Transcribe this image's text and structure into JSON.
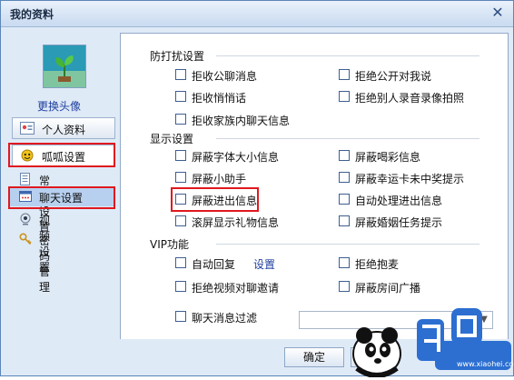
{
  "window": {
    "title": "我的资料",
    "close_symbol": "✕"
  },
  "sidebar": {
    "change_avatar": "更换头像",
    "items": [
      {
        "label": "个人资料"
      },
      {
        "label": "呱呱设置"
      }
    ],
    "sub_items": [
      {
        "label": "常规设置"
      },
      {
        "label": "聊天设置"
      },
      {
        "label": "视频设置"
      },
      {
        "label": "密码管理"
      }
    ]
  },
  "sections": {
    "disturb": {
      "title": "防打扰设置",
      "options": [
        "拒收公聊消息",
        "拒绝公开对我说",
        "拒收悄悄话",
        "拒绝别人录音录像拍照",
        "拒收家族内聊天信息"
      ]
    },
    "display": {
      "title": "显示设置",
      "options": [
        "屏蔽字体大小信息",
        "屏蔽喝彩信息",
        "屏蔽小助手",
        "屏蔽幸运卡未中奖提示",
        "屏蔽进出信息",
        "自动处理进出信息",
        "滚屏显示礼物信息",
        "屏蔽婚姻任务提示"
      ]
    },
    "vip": {
      "title": "VIP功能",
      "options": [
        "自动回复",
        "拒绝抱麦",
        "拒绝视频对聊邀请",
        "屏蔽房间广播",
        "聊天消息过滤"
      ],
      "settings_link": "设置"
    }
  },
  "filter_select": {
    "value": ""
  },
  "footer": {
    "ok": "确定"
  },
  "watermark": {
    "url": "www.xiaohei.com"
  },
  "colors": {
    "accent_highlight": "#e0191f",
    "link": "#1f3f9f"
  }
}
